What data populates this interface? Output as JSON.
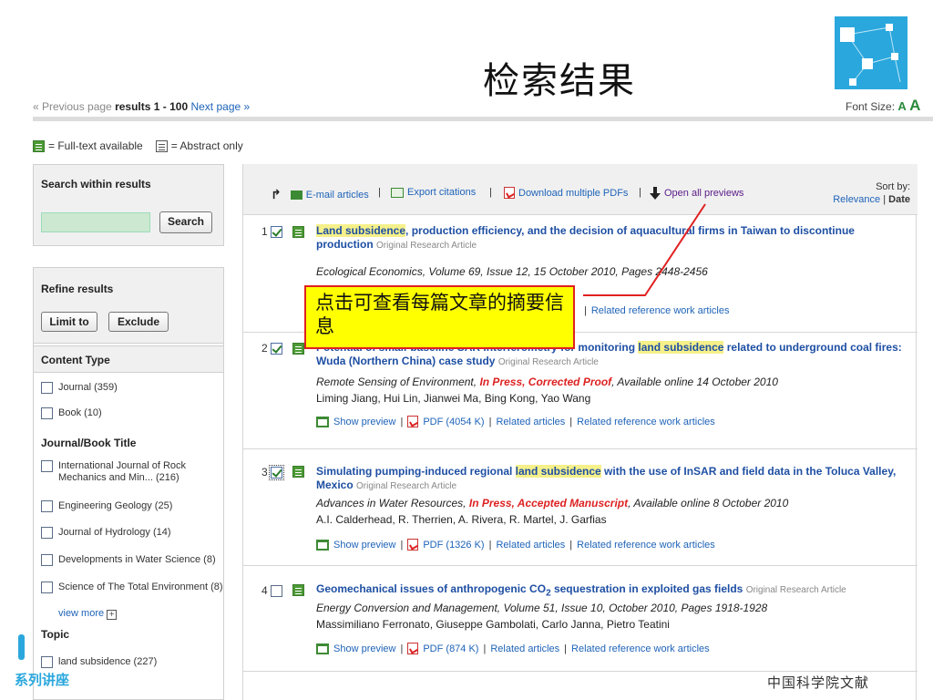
{
  "slide": {
    "title": "检索结果"
  },
  "pager": {
    "previous": "« Previous page",
    "results": "results 1 - 100",
    "next": "Next page »"
  },
  "font_size": {
    "label": "Font Size:",
    "a_small": "A",
    "a_large": "A"
  },
  "legend": {
    "fulltext": "= Full-text available",
    "abstract": "= Abstract only"
  },
  "search_within": {
    "heading": "Search within results",
    "input_value": "",
    "button": "Search"
  },
  "refine": {
    "heading": "Refine results",
    "limit": "Limit to",
    "exclude": "Exclude"
  },
  "facets": {
    "content_type_heading": "Content Type",
    "content_type": [
      "Journal (359)",
      "Book (10)"
    ],
    "journal_heading": "Journal/Book Title",
    "journals": [
      "International Journal of Rock Mechanics and Min... (216)",
      "Engineering Geology (25)",
      "Journal of Hydrology (14)",
      "Developments in Water Science (8)",
      "Science of The Total Environment (8)"
    ],
    "view_more": "view more",
    "topic_heading": "Topic",
    "topics": [
      "land subsidence (227)"
    ]
  },
  "toolbar": {
    "email": "E-mail articles",
    "export": "Export citations",
    "download": "Download multiple PDFs",
    "open_previews": "Open all previews",
    "sort_label": "Sort by:",
    "sort_relevance": "Relevance",
    "sort_date": "Date"
  },
  "results": [
    {
      "num": "1",
      "checked": true,
      "title_hl": "Land subsidence",
      "title_rest": ", production efficiency, and the decision of aquacultural firms in Taiwan to discontinue production",
      "type": "Original Research Article",
      "source": "Ecological Economics, Volume 69, Issue 12, 15 October 2010, Pages 2448-2456",
      "links_tail": "Related reference work articles"
    },
    {
      "num": "2",
      "checked": true,
      "title_pre": "Potential of small-baseline SAR interferometry for monitoring ",
      "title_hl": "land subsidence",
      "title_rest": " related to underground coal fires: Wuda (Northern China) case study",
      "type": "Original Research Article",
      "source_pre": "Remote Sensing of Environment, ",
      "source_press": "In Press, Corrected Proof",
      "source_post": ", Available online 14 October 2010",
      "authors": "Liming Jiang, Hui Lin, Jianwei Ma, Bing Kong, Yao Wang",
      "preview": "Show preview",
      "pdf": "PDF (4054 K)",
      "related": "Related articles",
      "related_ref": "Related reference work articles"
    },
    {
      "num": "3",
      "checked": true,
      "title_pre": "Simulating pumping-induced regional ",
      "title_hl": "land subsidence",
      "title_rest": " with the use of InSAR and field data in the Toluca Valley, Mexico",
      "type": "Original Research Article",
      "source_pre": "Advances in Water Resources, ",
      "source_press": "In Press, Accepted Manuscript",
      "source_post": ", Available online 8 October 2010",
      "authors": "A.I. Calderhead, R. Therrien, A. Rivera, R. Martel, J. Garfias",
      "preview": "Show preview",
      "pdf": "PDF (1326 K)",
      "related": "Related articles",
      "related_ref": "Related reference work articles"
    },
    {
      "num": "4",
      "checked": false,
      "title": "Geomechanical issues of anthropogenic CO",
      "title_sub": "2",
      "title_rest": " sequestration in exploited gas fields",
      "type": "Original Research Article",
      "source": "Energy Conversion and Management, Volume 51, Issue 10, October 2010, Pages 1918-1928",
      "authors": "Massimiliano Ferronato, Giuseppe Gambolati, Carlo Janna, Pietro Teatini",
      "preview": "Show preview",
      "pdf": "PDF (874 K)",
      "related": "Related articles",
      "related_ref": "Related reference work articles"
    }
  ],
  "callout": {
    "text": "点击可查看每篇文章的摘要信息"
  },
  "footer": {
    "left": "系列讲座",
    "right": "中国科学院文献"
  },
  "colors": {
    "link": "#1e63b8",
    "highlight": "#f5f08a",
    "callout_bg": "#ffff00",
    "callout_border": "#e02020",
    "accent": "#2aa7dd"
  }
}
